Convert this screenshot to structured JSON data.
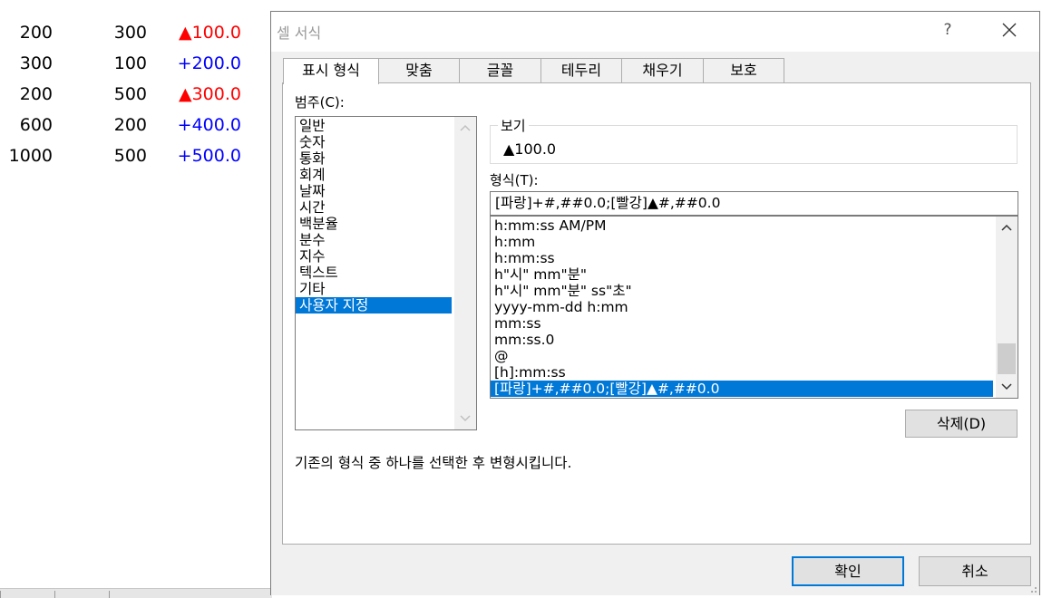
{
  "sheet": {
    "rows": [
      {
        "a": "200",
        "b": "300",
        "c": "▲100.0",
        "c_color": "red"
      },
      {
        "a": "300",
        "b": "100",
        "c": "+200.0",
        "c_color": "blue"
      },
      {
        "a": "200",
        "b": "500",
        "c": "▲300.0",
        "c_color": "red"
      },
      {
        "a": "600",
        "b": "200",
        "c": "+400.0",
        "c_color": "blue"
      },
      {
        "a": "1000",
        "b": "500",
        "c": "+500.0",
        "c_color": "blue"
      }
    ]
  },
  "dialog": {
    "title": "셀 서식",
    "help": "?",
    "tabs": [
      {
        "label": "표시 형식",
        "active": true
      },
      {
        "label": "맞춤"
      },
      {
        "label": "글꼴"
      },
      {
        "label": "테두리"
      },
      {
        "label": "채우기"
      },
      {
        "label": "보호"
      }
    ],
    "category_label": "범주(C):",
    "categories": [
      "일반",
      "숫자",
      "통화",
      "회계",
      "날짜",
      "시간",
      "백분율",
      "분수",
      "지수",
      "텍스트",
      "기타",
      "사용자 지정"
    ],
    "selected_category": "사용자 지정",
    "preview_label": "보기",
    "preview_value": "▲100.0",
    "format_label": "형식(T):",
    "format_input": "[파랑]+#,##0.0;[빨강]▲#,##0.0",
    "formats": [
      "h:mm:ss AM/PM",
      "h:mm",
      "h:mm:ss",
      "h\"시\" mm\"분\"",
      "h\"시\" mm\"분\" ss\"초\"",
      "yyyy-mm-dd h:mm",
      "mm:ss",
      "mm:ss.0",
      "@",
      "[h]:mm:ss",
      "[파랑]+#,##0.0;[빨강]▲#,##0.0"
    ],
    "selected_format": "[파랑]+#,##0.0;[빨강]▲#,##0.0",
    "delete_button": "삭제(D)",
    "description": "기존의 형식 중 하나를 선택한 후 변형시킵니다.",
    "ok_button": "확인",
    "cancel_button": "취소"
  },
  "colors": {
    "accent": "#0078d7",
    "negative": "#ff0000",
    "positive": "#0000ff"
  }
}
